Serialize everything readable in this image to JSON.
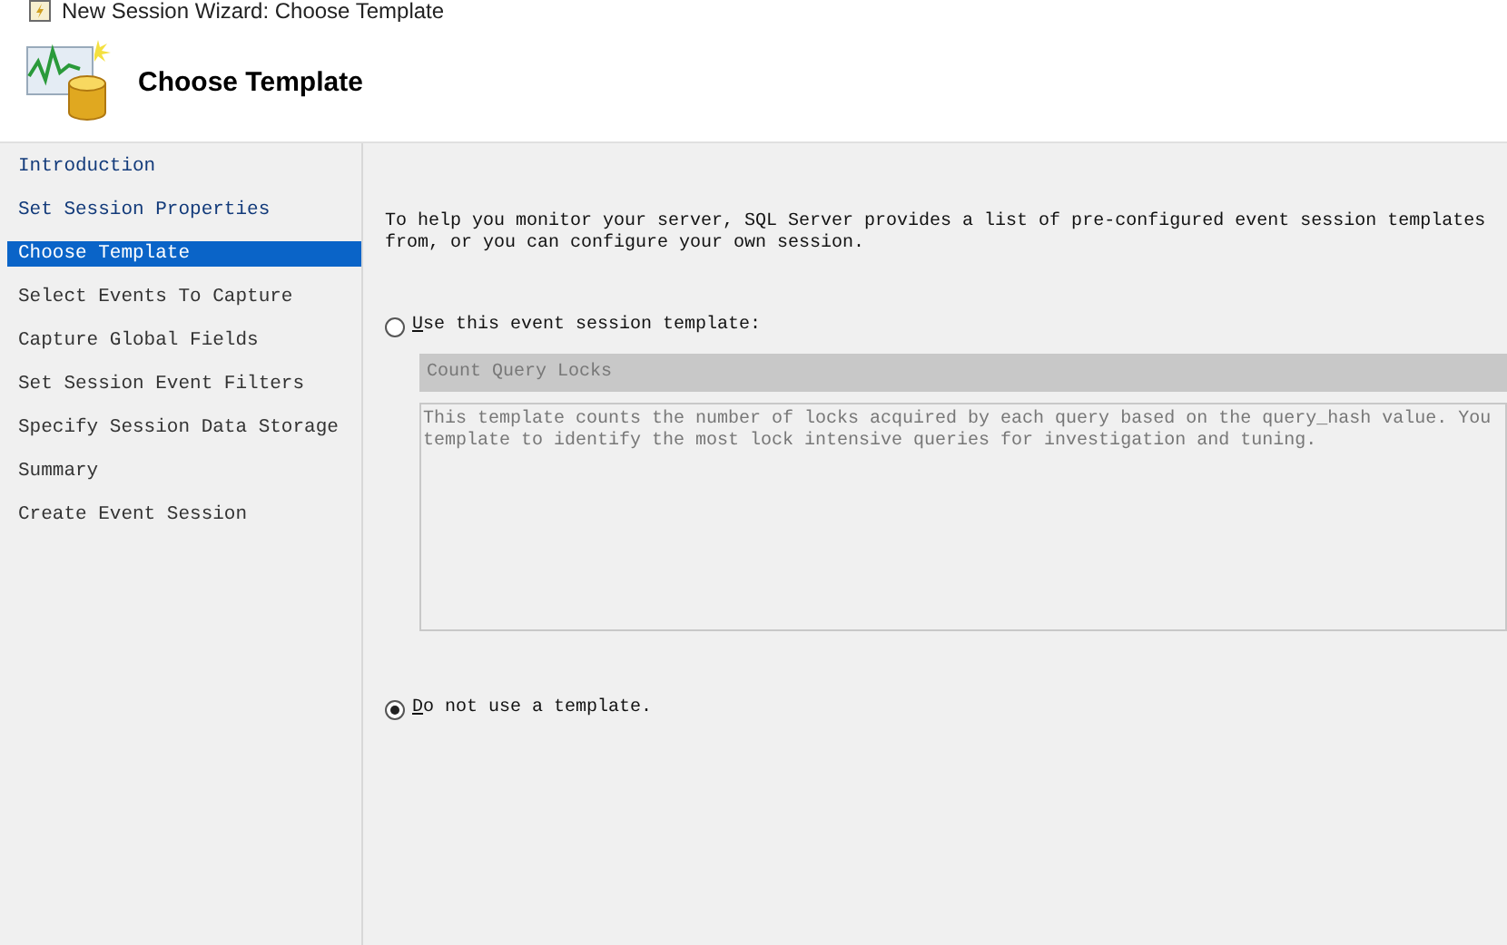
{
  "window": {
    "title": "New Session Wizard: Choose Template"
  },
  "header": {
    "title": "Choose Template"
  },
  "sidebar": {
    "items": [
      {
        "label": "Introduction",
        "selected": false
      },
      {
        "label": "Set Session Properties",
        "selected": false
      },
      {
        "label": "Choose Template",
        "selected": true
      },
      {
        "label": "Select Events To Capture",
        "selected": false
      },
      {
        "label": "Capture Global Fields",
        "selected": false
      },
      {
        "label": "Set Session Event Filters",
        "selected": false
      },
      {
        "label": "Specify Session Data Storage",
        "selected": false
      },
      {
        "label": "Summary",
        "selected": false
      },
      {
        "label": "Create Event Session",
        "selected": false
      }
    ]
  },
  "intro": [
    "To help you monitor your server, SQL Server provides a list of pre-configured event session templates",
    "from, or you can configure your own session."
  ],
  "options": [
    {
      "label": "Use this event session template:",
      "selected": false,
      "kind": "template"
    },
    {
      "label": "Do not use a template.",
      "selected": true,
      "kind": "none"
    }
  ],
  "template": {
    "value": "Count Query Locks",
    "description": [
      "This template counts the number of locks acquired by each query based on the query_hash value. You",
      "template to identify the most lock intensive queries for investigation and tuning."
    ]
  }
}
